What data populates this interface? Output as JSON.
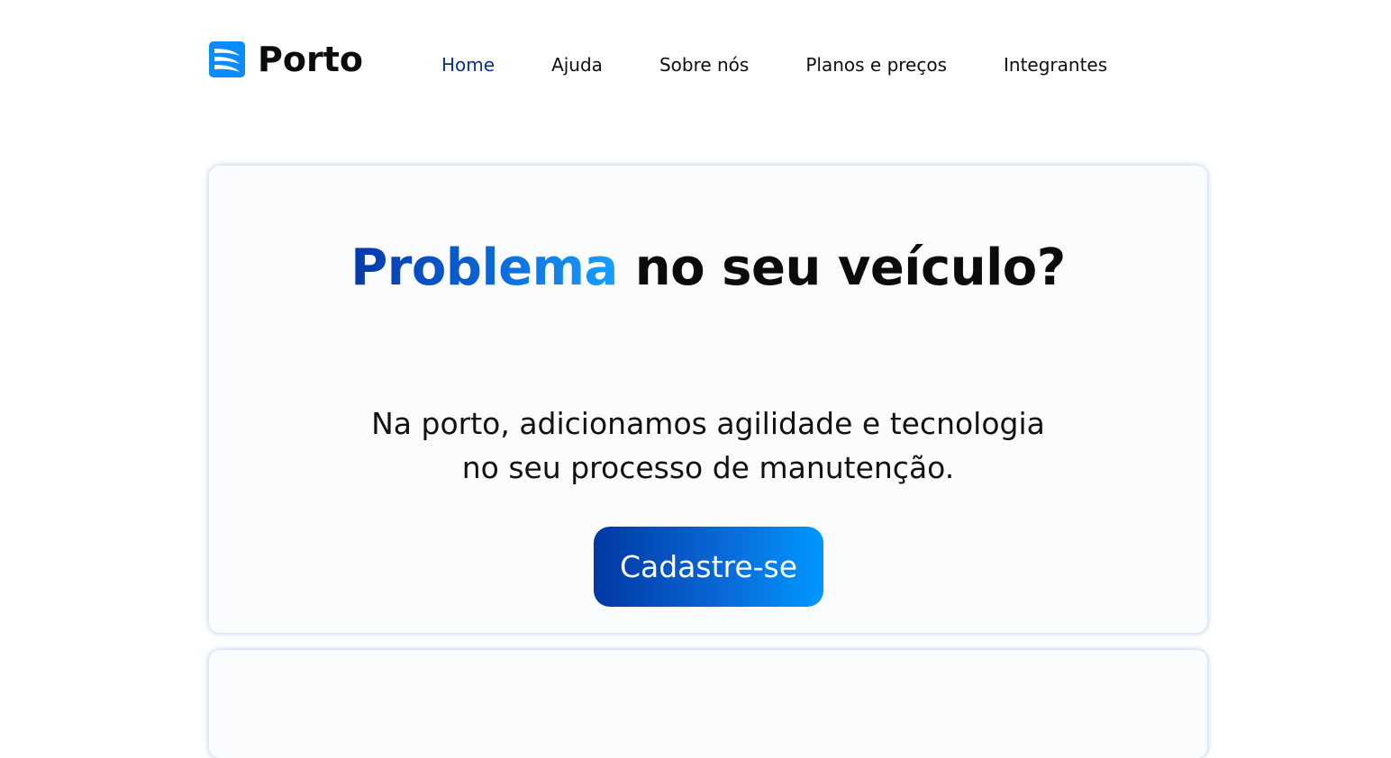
{
  "brand": {
    "name": "Porto",
    "icon": "porto-logo-icon",
    "color": "#0a8cff"
  },
  "nav": {
    "items": [
      {
        "label": "Home",
        "active": true
      },
      {
        "label": "Ajuda",
        "active": false
      },
      {
        "label": "Sobre nós",
        "active": false
      },
      {
        "label": "Planos e preços",
        "active": false
      },
      {
        "label": "Integrantes",
        "active": false
      }
    ],
    "active_color": "#0a2f8f"
  },
  "hero": {
    "title_highlight": "Problema",
    "title_rest": " no seu veículo?",
    "description_line1": "Na porto, adicionamos agilidade e tecnologia",
    "description_line2": "no seu processo de manutenção.",
    "cta_label": "Cadastre-se",
    "gradient_start": "#0038a2",
    "gradient_end": "#0098ff"
  }
}
